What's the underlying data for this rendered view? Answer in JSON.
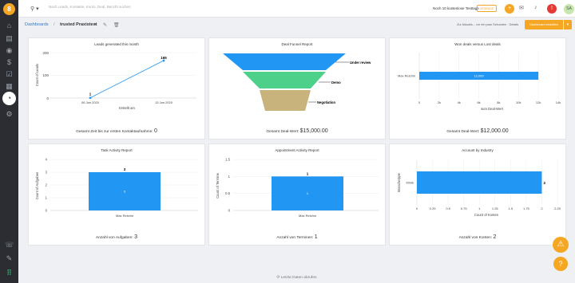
{
  "sidebar": {
    "logo": "8",
    "icons": [
      "home-icon",
      "chart-icon",
      "contacts-icon",
      "deals-icon",
      "tasks-icon",
      "calendar-icon",
      "folder-icon",
      "messages-icon",
      "reports-icon",
      "settings-icon",
      "phone-icon",
      "edit-icon",
      "apps-icon"
    ]
  },
  "topbar": {
    "search_placeholder": "Nach Leads, Kontakte, Konto, Deal, Bericht suchen",
    "trial_text": "Noch 10 kostenlose Testtage",
    "upgrade_label": "UPGRADE",
    "avatar_initials": "SA"
  },
  "subbar": {
    "breadcrumb": "Dashboards",
    "separator": "/",
    "dashboard_name": "trusted Praxistest",
    "updated_text": "Zur Aktualis... vor ein paar Sekunden · Details",
    "edit_button": "Dashboard erstellen"
  },
  "colors": {
    "accent": "#f5a623",
    "bar": "#2196f3",
    "funnel1": "#2196f3",
    "funnel2": "#4cd08a",
    "funnel3": "#c9b37d",
    "red": "#e53935"
  },
  "cards": [
    {
      "title": "Leads generated this month",
      "footer_label": "Gesamt Zeit bis zur ersten Kontaktaufnahme:",
      "footer_value": "0"
    },
    {
      "title": "Deal Funnel Report",
      "footer_label": "Gesamt Deal-Wert:",
      "footer_value": "$15,000.00"
    },
    {
      "title": "Won deals versus Lost deals",
      "footer_label": "Gesamt Deal-Wert:",
      "footer_value": "$12,000.00"
    },
    {
      "title": "Task Activity Report",
      "footer_label": "Anzahl von Aufgaben:",
      "footer_value": "3"
    },
    {
      "title": "Appointment Activity Report",
      "footer_label": "Anzahl von Terminen:",
      "footer_value": "1"
    },
    {
      "title": "Account by Industry",
      "footer_label": "Anzahl von Konten:",
      "footer_value": "2"
    }
  ],
  "chart_data": [
    {
      "type": "line",
      "x": [
        "06 Jan 2020",
        "13 Jan 2020"
      ],
      "y": [
        1,
        165
      ],
      "ylim": [
        0,
        200
      ],
      "yticks": [
        0,
        100,
        200
      ],
      "xlabel": "Erstellt am",
      "ylabel": "Count of Leads"
    },
    {
      "type": "funnel",
      "stages": [
        {
          "name": "Under review",
          "color": "#2196f3"
        },
        {
          "name": "Demo",
          "color": "#4cd08a"
        },
        {
          "name": "Negotiation",
          "color": "#c9b37d"
        }
      ]
    },
    {
      "type": "bar",
      "orientation": "horizontal",
      "categories": [
        "Max Reichin"
      ],
      "values": [
        12000
      ],
      "value_labels": [
        "12,000"
      ],
      "xlim": [
        0,
        14000
      ],
      "xticks": [
        "0",
        "2k",
        "4k",
        "6k",
        "8k",
        "10k",
        "12k",
        "14k"
      ],
      "xlabel": "sum Deal-Wert"
    },
    {
      "type": "bar",
      "categories": [
        "Max Reichin"
      ],
      "values": [
        3
      ],
      "ylim": [
        0,
        4
      ],
      "yticks": [
        0,
        1,
        2,
        3,
        4
      ],
      "ylabel": "Count of Aufgaben",
      "inner_label": "3"
    },
    {
      "type": "bar",
      "categories": [
        "Max Reichin"
      ],
      "values": [
        1
      ],
      "ylim": [
        0,
        1.5
      ],
      "yticks": [
        "0",
        "0.5",
        "1",
        "1.5"
      ],
      "ylabel": "Count of Termine",
      "inner_label": "1"
    },
    {
      "type": "bar",
      "orientation": "horizontal",
      "categories": [
        "Klinik"
      ],
      "values": [
        2
      ],
      "xlim": [
        0,
        2.25
      ],
      "xticks": [
        "0",
        "0.25",
        "0.5",
        "0.75",
        "1",
        "1.25",
        "1.5",
        "1.75",
        "2",
        "2.25"
      ],
      "xlabel": "Count of Konten",
      "ylabel": "Branche/ppe"
    }
  ],
  "footer": {
    "text": "Letzte Daten abrufen"
  }
}
